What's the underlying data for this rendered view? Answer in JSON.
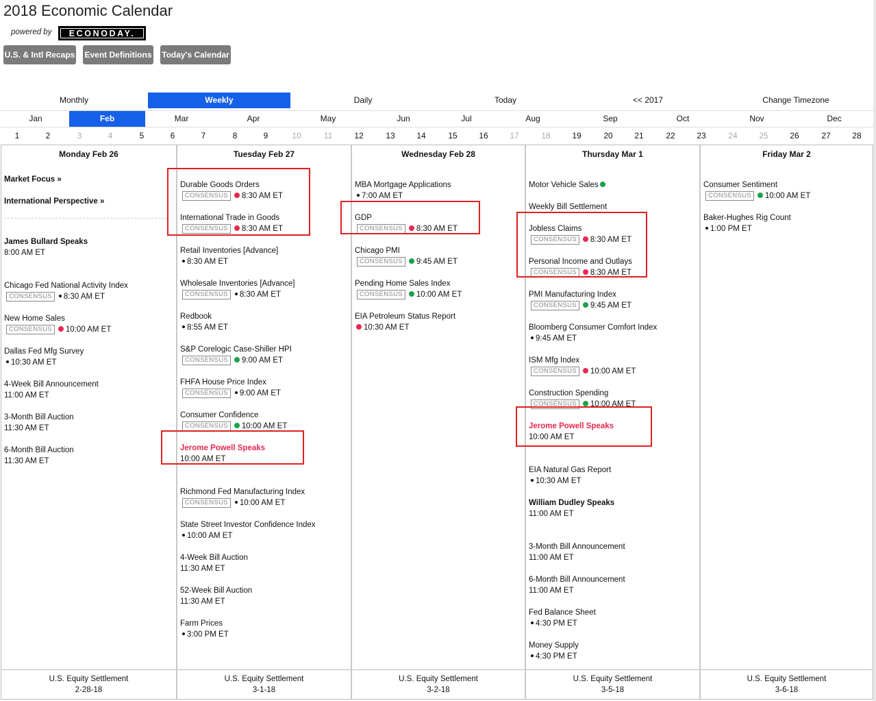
{
  "header": {
    "title": "2018 Economic Calendar",
    "powered_by": "powered by",
    "logo_text": "ECONODAY."
  },
  "buttons": [
    "U.S. & Intl Recaps",
    "Event Definitions",
    "Today's Calendar"
  ],
  "view_tabs": {
    "items": [
      "Monthly",
      "Weekly",
      "Daily",
      "Today",
      "<< 2017",
      "Change Timezone"
    ],
    "active": "Weekly"
  },
  "months": {
    "items": [
      "Jan",
      "Feb",
      "Mar",
      "Apr",
      "May",
      "Jun",
      "Jul",
      "Aug",
      "Sep",
      "Oct",
      "Nov",
      "Dec"
    ],
    "active": "Feb"
  },
  "day_numbers": [
    "1",
    "2",
    "3",
    "4",
    "5",
    "6",
    "7",
    "8",
    "9",
    "10",
    "11",
    "12",
    "13",
    "14",
    "15",
    "16",
    "17",
    "18",
    "19",
    "20",
    "21",
    "22",
    "23",
    "24",
    "25",
    "26",
    "27",
    "28"
  ],
  "dim_days": [
    "3",
    "4",
    "10",
    "11",
    "17",
    "18",
    "24",
    "25"
  ],
  "days": [
    {
      "header": "Monday Feb 26",
      "links": [
        "Market Focus »",
        "International Perspective »"
      ],
      "events": [
        {
          "name": "James Bullard Speaks",
          "time": "8:00 AM ET",
          "style": "bold"
        },
        {
          "name": "Chicago Fed National Activity Index",
          "time": "8:30 AM ET",
          "consensus": true,
          "dot": "black"
        },
        {
          "name": "New Home Sales",
          "time": "10:00 AM ET",
          "consensus": true,
          "dot": "red"
        },
        {
          "name": "Dallas Fed Mfg Survey",
          "time": "10:30 AM ET",
          "dot": "black"
        },
        {
          "name": "4-Week Bill Announcement",
          "time": "11:00 AM ET"
        },
        {
          "name": "3-Month Bill Auction",
          "time": "11:30 AM ET"
        },
        {
          "name": "6-Month Bill Auction",
          "time": "11:30 AM ET"
        }
      ],
      "settlement": [
        "U.S. Equity Settlement",
        "2-28-18"
      ]
    },
    {
      "header": "Tuesday Feb 27",
      "events": [
        {
          "name": "Durable Goods Orders",
          "time": "8:30 AM ET",
          "consensus": true,
          "dot": "red"
        },
        {
          "name": "International Trade in Goods",
          "time": "8:30 AM ET",
          "consensus": true,
          "dot": "red"
        },
        {
          "name": "Retail Inventories [Advance]",
          "time": "8:30 AM ET",
          "dot": "black"
        },
        {
          "name": "Wholesale Inventories [Advance]",
          "time": "8:30 AM ET",
          "consensus": true,
          "dot": "black"
        },
        {
          "name": "Redbook",
          "time": "8:55 AM ET",
          "dot": "black"
        },
        {
          "name": "S&P Corelogic Case-Shiller HPI",
          "time": "9:00 AM ET",
          "consensus": true,
          "dot": "green"
        },
        {
          "name": "FHFA House Price Index",
          "time": "9:00 AM ET",
          "consensus": true,
          "dot": "black"
        },
        {
          "name": "Consumer Confidence",
          "time": "10:00 AM ET",
          "consensus": true,
          "dot": "green"
        },
        {
          "name": "Jerome Powell Speaks",
          "time": "10:00 AM ET",
          "style": "red"
        },
        {
          "name": "Richmond Fed Manufacturing Index",
          "time": "10:00 AM ET",
          "consensus": true,
          "dot": "black"
        },
        {
          "name": "State Street Investor Confidence Index",
          "time": "10:00 AM ET",
          "dot": "black"
        },
        {
          "name": "4-Week Bill Auction",
          "time": "11:30 AM ET"
        },
        {
          "name": "52-Week Bill Auction",
          "time": "11:30 AM ET"
        },
        {
          "name": "Farm Prices",
          "time": "3:00 PM ET",
          "dot": "black"
        }
      ],
      "settlement": [
        "U.S. Equity Settlement",
        "3-1-18"
      ]
    },
    {
      "header": "Wednesday Feb 28",
      "events": [
        {
          "name": "MBA Mortgage Applications",
          "time": "7:00 AM ET",
          "dot": "black"
        },
        {
          "name": "GDP",
          "time": "8:30 AM ET",
          "consensus": true,
          "dot": "red"
        },
        {
          "name": "Chicago PMI",
          "time": "9:45 AM ET",
          "consensus": true,
          "dot": "green"
        },
        {
          "name": "Pending Home Sales Index",
          "time": "10:00 AM ET",
          "consensus": true,
          "dot": "green"
        },
        {
          "name": "EIA Petroleum Status Report",
          "time": "10:30 AM ET",
          "dot": "red"
        }
      ],
      "settlement": [
        "U.S. Equity Settlement",
        "3-2-18"
      ]
    },
    {
      "header": "Thursday Mar 1",
      "events": [
        {
          "name": "Motor Vehicle Sales",
          "time": "",
          "dot": "green"
        },
        {
          "name": "Weekly Bill Settlement",
          "time": ""
        },
        {
          "name": "Jobless Claims",
          "time": "8:30 AM ET",
          "consensus": true,
          "dot": "red"
        },
        {
          "name": "Personal Income and Outlays",
          "time": "8:30 AM ET",
          "consensus": true,
          "dot": "red"
        },
        {
          "name": "PMI Manufacturing Index",
          "time": "9:45 AM ET",
          "consensus": true,
          "dot": "green"
        },
        {
          "name": "Bloomberg Consumer Comfort Index",
          "time": "9:45 AM ET",
          "dot": "black"
        },
        {
          "name": "ISM Mfg Index",
          "time": "10:00 AM ET",
          "consensus": true,
          "dot": "red"
        },
        {
          "name": "Construction Spending",
          "time": "10:00 AM ET",
          "consensus": true,
          "dot": "green"
        },
        {
          "name": "Jerome Powell Speaks",
          "time": "10:00 AM ET",
          "style": "red"
        },
        {
          "name": "EIA Natural Gas Report",
          "time": "10:30 AM ET",
          "dot": "black"
        },
        {
          "name": "William Dudley Speaks",
          "time": "11:00 AM ET",
          "style": "bold"
        },
        {
          "name": "3-Month Bill Announcement",
          "time": "11:00 AM ET"
        },
        {
          "name": "6-Month Bill Announcement",
          "time": "11:00 AM ET"
        },
        {
          "name": "Fed Balance Sheet",
          "time": "4:30 PM ET",
          "dot": "black"
        },
        {
          "name": "Money Supply",
          "time": "4:30 PM ET",
          "dot": "black"
        }
      ],
      "settlement": [
        "U.S. Equity Settlement",
        "3-5-18"
      ]
    },
    {
      "header": "Friday Mar 2",
      "events": [
        {
          "name": "Consumer Sentiment",
          "time": "10:00 AM ET",
          "consensus": true,
          "dot": "green"
        },
        {
          "name": "Baker-Hughes Rig Count",
          "time": "1:00 PM ET",
          "dot": "black"
        }
      ],
      "settlement": [
        "U.S. Equity Settlement",
        "3-6-18"
      ]
    }
  ],
  "consensus_label": "CONSENSUS",
  "colors": {
    "accent": "#1560e8",
    "red": "#e8294f",
    "green": "#1aa34a",
    "highlight": "#e02020"
  }
}
